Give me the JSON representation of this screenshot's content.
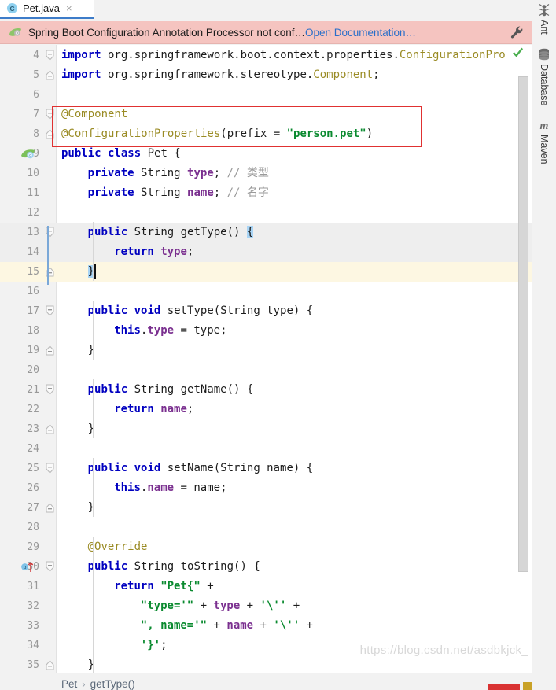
{
  "window": {
    "tab": {
      "label": "Pet.java",
      "icon": "java-class-icon",
      "close": "×"
    }
  },
  "notification": {
    "icon": "spring-leaf-icon",
    "message": "Spring Boot Configuration Annotation Processor not conf…",
    "link": "Open Documentation…",
    "action_icon": "wrench-icon",
    "background": "#f5c4c0",
    "link_color": "#2a6fc9"
  },
  "editor": {
    "first_visible_line": 4,
    "caret_line": 15,
    "lines": [
      {
        "num": 4,
        "gutter_icon": null,
        "fold": "expanded",
        "indent": 0,
        "tokens": [
          {
            "t": "import",
            "c": "kw"
          },
          {
            "t": " org.springframework.boot.context.properties.",
            "c": "plain"
          },
          {
            "t": "ConfigurationPro",
            "c": "ann"
          }
        ]
      },
      {
        "num": 5,
        "gutter_icon": null,
        "fold": "collapsed-end",
        "indent": 0,
        "tokens": [
          {
            "t": "import",
            "c": "kw"
          },
          {
            "t": " org.springframework.stereotype.",
            "c": "plain"
          },
          {
            "t": "Component",
            "c": "ann"
          },
          {
            "t": ";",
            "c": "plain"
          }
        ]
      },
      {
        "num": 6,
        "gutter_icon": null,
        "fold": null,
        "indent": 0,
        "tokens": []
      },
      {
        "num": 7,
        "gutter_icon": null,
        "fold": "expanded",
        "indent": 0,
        "tokens": [
          {
            "t": "@Component",
            "c": "ann"
          }
        ]
      },
      {
        "num": 8,
        "gutter_icon": null,
        "fold": "collapsed-end",
        "indent": 0,
        "tokens": [
          {
            "t": "@ConfigurationProperties",
            "c": "ann"
          },
          {
            "t": "(prefix = ",
            "c": "plain"
          },
          {
            "t": "\"person.pet\"",
            "c": "str"
          },
          {
            "t": ")",
            "c": "plain"
          }
        ]
      },
      {
        "num": 9,
        "gutter_icon": "spring-bean-icon",
        "fold": null,
        "indent": 0,
        "tokens": [
          {
            "t": "public class",
            "c": "kw"
          },
          {
            "t": " Pet {",
            "c": "plain"
          }
        ]
      },
      {
        "num": 10,
        "gutter_icon": null,
        "fold": null,
        "indent": 1,
        "tokens": [
          {
            "t": "private",
            "c": "kw"
          },
          {
            "t": " String ",
            "c": "plain"
          },
          {
            "t": "type",
            "c": "fld"
          },
          {
            "t": "; ",
            "c": "plain"
          },
          {
            "t": "// 类型",
            "c": "cmt"
          }
        ]
      },
      {
        "num": 11,
        "gutter_icon": null,
        "fold": null,
        "indent": 1,
        "tokens": [
          {
            "t": "private",
            "c": "kw"
          },
          {
            "t": " String ",
            "c": "plain"
          },
          {
            "t": "name",
            "c": "fld"
          },
          {
            "t": "; ",
            "c": "plain"
          },
          {
            "t": "// 名字",
            "c": "cmt"
          }
        ]
      },
      {
        "num": 12,
        "gutter_icon": null,
        "fold": null,
        "indent": 1,
        "tokens": []
      },
      {
        "num": 13,
        "gutter_icon": null,
        "fold": "expanded",
        "indent": 1,
        "highlight": "soft",
        "tokens": [
          {
            "t": "public",
            "c": "kw"
          },
          {
            "t": " String getType() ",
            "c": "plain"
          },
          {
            "t": "{",
            "c": "brace-hl"
          }
        ]
      },
      {
        "num": 14,
        "gutter_icon": null,
        "fold": null,
        "indent": 2,
        "highlight": "soft",
        "tokens": [
          {
            "t": "return",
            "c": "kw"
          },
          {
            "t": " ",
            "c": "plain"
          },
          {
            "t": "type",
            "c": "fld"
          },
          {
            "t": ";",
            "c": "plain"
          }
        ]
      },
      {
        "num": 15,
        "gutter_icon": null,
        "fold": "collapsed-end",
        "indent": 1,
        "highlight": "caret",
        "tokens": [
          {
            "t": "}",
            "c": "brace-hl"
          }
        ]
      },
      {
        "num": 16,
        "gutter_icon": null,
        "fold": null,
        "indent": 1,
        "tokens": []
      },
      {
        "num": 17,
        "gutter_icon": null,
        "fold": "expanded",
        "indent": 1,
        "tokens": [
          {
            "t": "public void",
            "c": "kw"
          },
          {
            "t": " setType(String type) {",
            "c": "plain"
          }
        ]
      },
      {
        "num": 18,
        "gutter_icon": null,
        "fold": null,
        "indent": 2,
        "tokens": [
          {
            "t": "this",
            "c": "kw"
          },
          {
            "t": ".",
            "c": "plain"
          },
          {
            "t": "type",
            "c": "fld"
          },
          {
            "t": " = type;",
            "c": "plain"
          }
        ]
      },
      {
        "num": 19,
        "gutter_icon": null,
        "fold": "collapsed-end",
        "indent": 1,
        "tokens": [
          {
            "t": "}",
            "c": "plain"
          }
        ]
      },
      {
        "num": 20,
        "gutter_icon": null,
        "fold": null,
        "indent": 1,
        "tokens": []
      },
      {
        "num": 21,
        "gutter_icon": null,
        "fold": "expanded",
        "indent": 1,
        "tokens": [
          {
            "t": "public",
            "c": "kw"
          },
          {
            "t": " String getName() {",
            "c": "plain"
          }
        ]
      },
      {
        "num": 22,
        "gutter_icon": null,
        "fold": null,
        "indent": 2,
        "tokens": [
          {
            "t": "return",
            "c": "kw"
          },
          {
            "t": " ",
            "c": "plain"
          },
          {
            "t": "name",
            "c": "fld"
          },
          {
            "t": ";",
            "c": "plain"
          }
        ]
      },
      {
        "num": 23,
        "gutter_icon": null,
        "fold": "collapsed-end",
        "indent": 1,
        "tokens": [
          {
            "t": "}",
            "c": "plain"
          }
        ]
      },
      {
        "num": 24,
        "gutter_icon": null,
        "fold": null,
        "indent": 1,
        "tokens": []
      },
      {
        "num": 25,
        "gutter_icon": null,
        "fold": "expanded",
        "indent": 1,
        "tokens": [
          {
            "t": "public void",
            "c": "kw"
          },
          {
            "t": " setName(String name) {",
            "c": "plain"
          }
        ]
      },
      {
        "num": 26,
        "gutter_icon": null,
        "fold": null,
        "indent": 2,
        "tokens": [
          {
            "t": "this",
            "c": "kw"
          },
          {
            "t": ".",
            "c": "plain"
          },
          {
            "t": "name",
            "c": "fld"
          },
          {
            "t": " = name;",
            "c": "plain"
          }
        ]
      },
      {
        "num": 27,
        "gutter_icon": null,
        "fold": "collapsed-end",
        "indent": 1,
        "tokens": [
          {
            "t": "}",
            "c": "plain"
          }
        ]
      },
      {
        "num": 28,
        "gutter_icon": null,
        "fold": null,
        "indent": 1,
        "tokens": []
      },
      {
        "num": 29,
        "gutter_icon": null,
        "fold": null,
        "indent": 1,
        "tokens": [
          {
            "t": "@Override",
            "c": "ann"
          }
        ]
      },
      {
        "num": 30,
        "gutter_icon": "override-method-icon",
        "fold": "expanded",
        "indent": 1,
        "tokens": [
          {
            "t": "public",
            "c": "kw"
          },
          {
            "t": " String toString() {",
            "c": "plain"
          }
        ]
      },
      {
        "num": 31,
        "gutter_icon": null,
        "fold": null,
        "indent": 2,
        "tokens": [
          {
            "t": "return",
            "c": "kw"
          },
          {
            "t": " ",
            "c": "plain"
          },
          {
            "t": "\"Pet{\"",
            "c": "str"
          },
          {
            "t": " +",
            "c": "plain"
          }
        ]
      },
      {
        "num": 32,
        "gutter_icon": null,
        "fold": null,
        "indent": 3,
        "tokens": [
          {
            "t": "\"type='\"",
            "c": "str"
          },
          {
            "t": " + ",
            "c": "plain"
          },
          {
            "t": "type",
            "c": "fld"
          },
          {
            "t": " + ",
            "c": "plain"
          },
          {
            "t": "'\\''",
            "c": "str"
          },
          {
            "t": " +",
            "c": "plain"
          }
        ]
      },
      {
        "num": 33,
        "gutter_icon": null,
        "fold": null,
        "indent": 3,
        "tokens": [
          {
            "t": "\", name='\"",
            "c": "str"
          },
          {
            "t": " + ",
            "c": "plain"
          },
          {
            "t": "name",
            "c": "fld"
          },
          {
            "t": " + ",
            "c": "plain"
          },
          {
            "t": "'\\''",
            "c": "str"
          },
          {
            "t": " +",
            "c": "plain"
          }
        ]
      },
      {
        "num": 34,
        "gutter_icon": null,
        "fold": null,
        "indent": 3,
        "tokens": [
          {
            "t": "'}'",
            "c": "str"
          },
          {
            "t": ";",
            "c": "plain"
          }
        ]
      },
      {
        "num": 35,
        "gutter_icon": null,
        "fold": "collapsed-end",
        "indent": 1,
        "tokens": [
          {
            "t": "}",
            "c": "plain"
          }
        ]
      }
    ],
    "inspection_box": {
      "color": "#e03131",
      "from_line": 7,
      "to_line": 8
    },
    "markers": {
      "ok_check": "green-check-icon"
    }
  },
  "breadcrumb": {
    "class": "Pet",
    "separator": "›",
    "method": "getType()"
  },
  "watermark": "https://blog.csdn.net/asdbkjck_",
  "rail": {
    "items": [
      {
        "label": "Ant",
        "icon": "ant-icon"
      },
      {
        "label": "Database",
        "icon": "database-icon"
      },
      {
        "label": "Maven",
        "icon": "maven-icon"
      }
    ]
  },
  "scrollbar": {
    "orientation": "vertical",
    "thumb_top_pct": 5,
    "thumb_height_pct": 79
  }
}
